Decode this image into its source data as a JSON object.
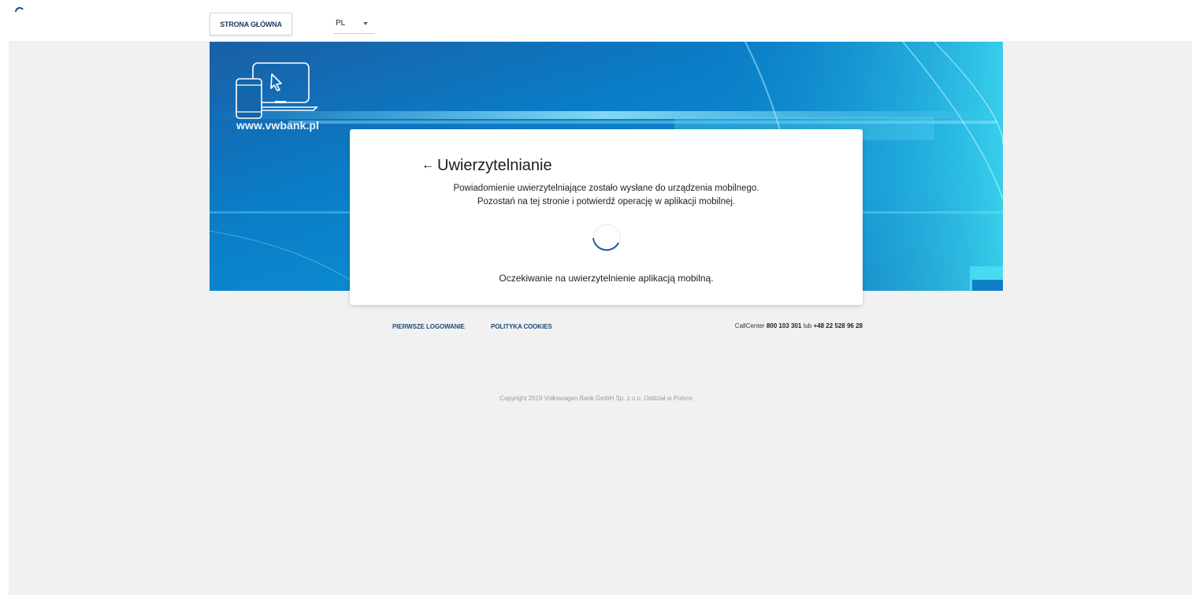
{
  "header": {
    "home_button": "STRONA GŁÓWNA",
    "language": "PL"
  },
  "banner": {
    "url_text": "www.vwbank.pl"
  },
  "auth": {
    "title": "Uwierzytelnianie",
    "back_arrow": "←",
    "message_line1": "Powiadomienie uwierzytelniające zostało wysłane do urządzenia mobilnego.",
    "message_line2": "Pozostań na tej stronie i potwierdź operację w aplikacji mobilnej.",
    "status": "Oczekiwanie na uwierzytelnienie aplikacją mobilną."
  },
  "footer": {
    "link_first_login": "PIERWSZE LOGOWANIE",
    "link_cookies": "POLITYKA COOKIES",
    "callcenter_label": "CallCenter",
    "callcenter_number1": "800 103 301",
    "callcenter_or": "lub",
    "callcenter_number2": "+48 22 528 96 28",
    "copyright": "Copyright 2019 Volkswagen Bank GmbH Sp. z o.o. Oddział w Polsce"
  },
  "colors": {
    "accent": "#1f3d63",
    "banner_blue": "#0a6fb8",
    "background": "#f1f1f1"
  }
}
